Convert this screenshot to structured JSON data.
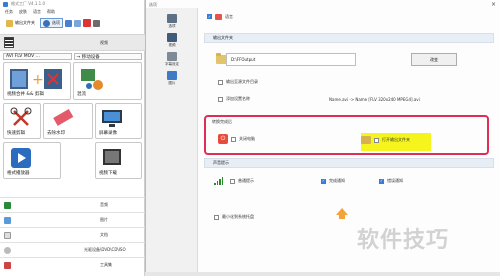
{
  "app": {
    "title": "格式工厂 V4.1.1.0",
    "menu": [
      "任务",
      "皮肤",
      "语言",
      "帮助"
    ],
    "toolbar": {
      "output_folder": "输出文件夹",
      "options": "选项"
    },
    "video_category": "视频",
    "formats": [
      "AVI FLV MOV ...",
      "→ 移动设备"
    ],
    "tiles": [
      "视频合并 && 剪辑",
      "混流",
      "快速剪辑",
      "去除水印",
      "屏幕录像",
      "格式播放器",
      "视频下载"
    ],
    "categories": [
      "音频",
      "图片",
      "文档",
      "光驱设备\\DVD\\CD\\ISO",
      "工具集"
    ]
  },
  "dialog": {
    "title": "选项",
    "sidebar": [
      "选项",
      "视频",
      "字幕设定",
      "图片"
    ],
    "theme_label": "语言",
    "output_section": "输出文件夹",
    "output_path": "D:\\FFOutput",
    "change_button": "改变",
    "option_output_dir": "输出至源文件目录",
    "option_add_name": "添加设置名称",
    "name_example": "Name.avi -> Name [FLV 320x240 MPEG4].avi",
    "after_convert_section": "转换完成后",
    "after_shutdown": "关闭电脑",
    "after_open_folder": "打开输出文件夹",
    "notify_section": "声音提示",
    "notify_normal": "普通提示",
    "notify_complete": "完成通知",
    "notify_error": "错误通知",
    "minimize_tray": "最小化到系统托盘",
    "watermark_text": "软件技巧",
    "colors": {
      "highlight_frame": "#e02d55",
      "highlight_fill": "#f5f51d",
      "accent": "#3a7bd5"
    }
  }
}
